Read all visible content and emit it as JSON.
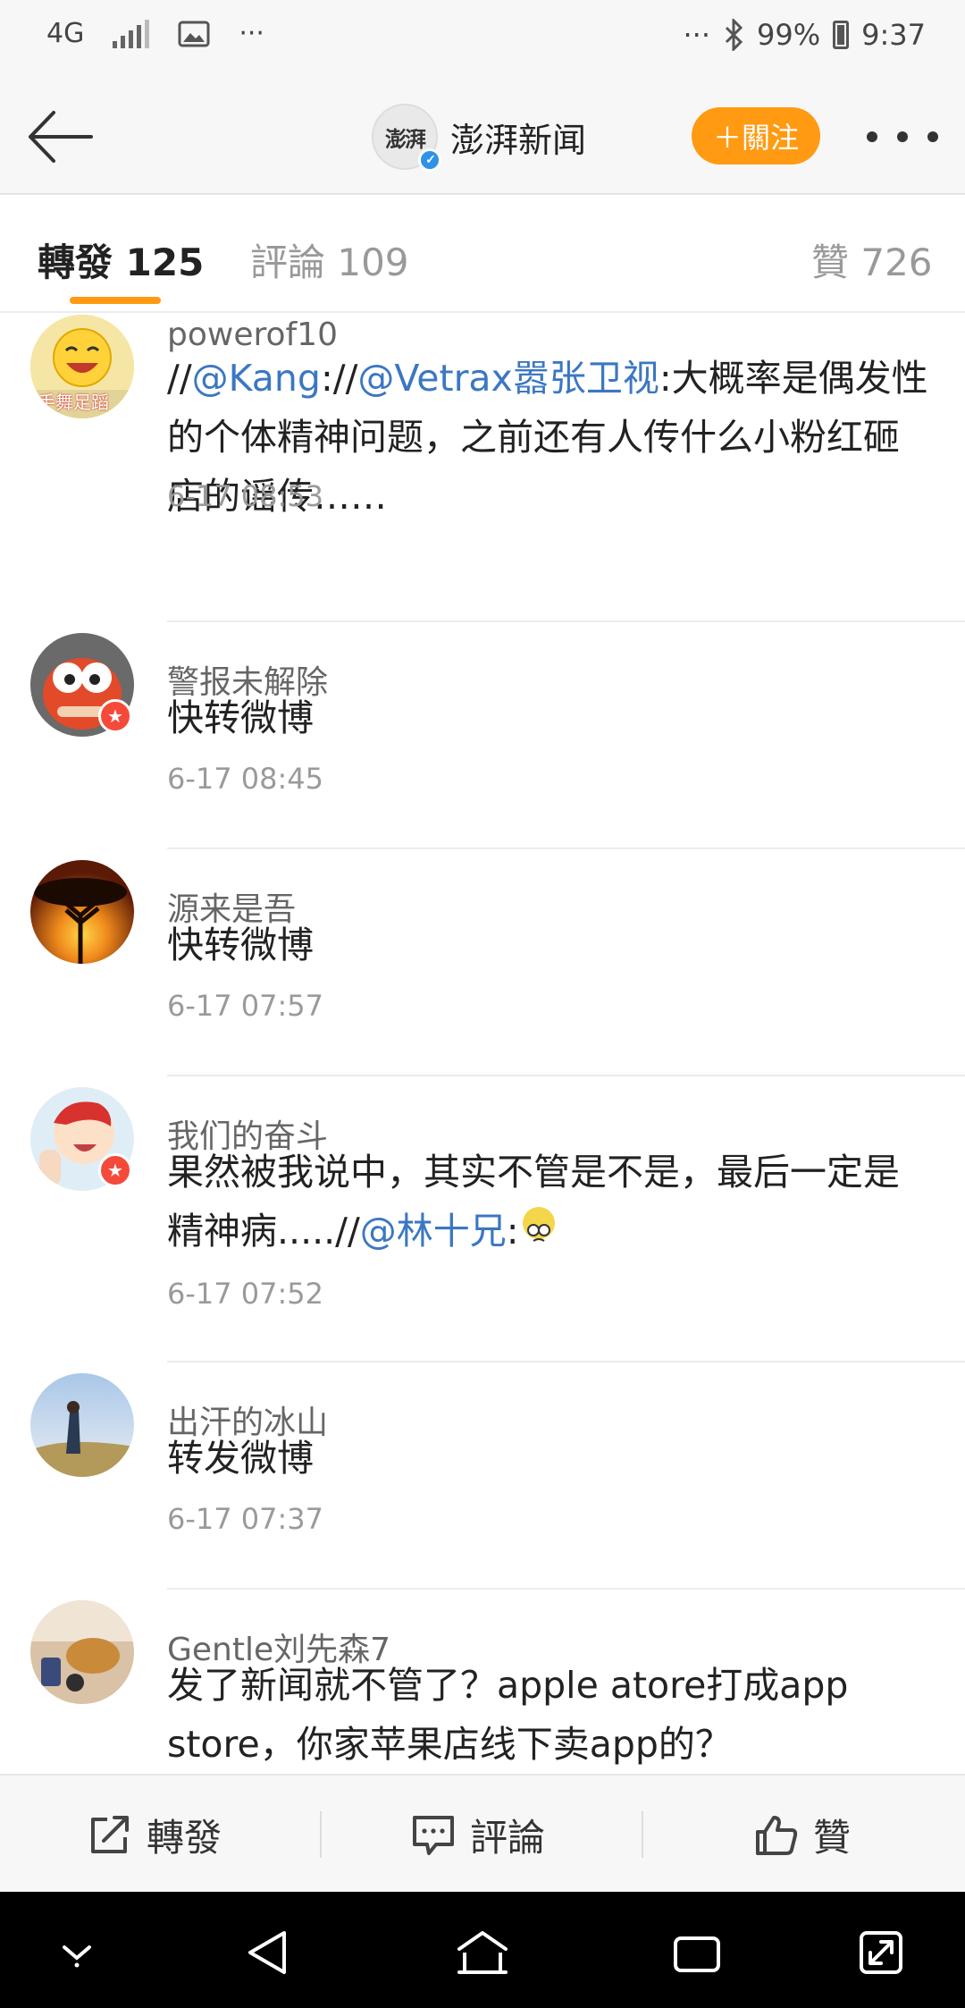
{
  "status_bar": {
    "network": "4G",
    "dots_left": "···",
    "dots_right": "···",
    "battery": "99%",
    "time": "9:37"
  },
  "header": {
    "account_name": "澎湃新闻",
    "logo_text": "澎湃",
    "follow_label": "＋關注"
  },
  "tabs": [
    {
      "label": "轉發 125",
      "active": true
    },
    {
      "label": "評論 109",
      "active": false
    },
    {
      "label": "贊 726",
      "active": false
    }
  ],
  "posts": [
    {
      "user": "powerof10",
      "avatar_text": "手舞足蹈",
      "content": [
        {
          "t": "//"
        },
        {
          "t": "@Kang",
          "at": true
        },
        {
          "t": "://"
        },
        {
          "t": "@Vetrax嚣张卫视",
          "at": true
        },
        {
          "t": ":大概率是偶发性的个体精神问题，之前还有人传什么小粉红砸店的谣传……"
        }
      ],
      "time": "6-17 08:53"
    },
    {
      "user": "警报未解除",
      "content": [
        {
          "t": "快转微博"
        }
      ],
      "time": "6-17 08:45"
    },
    {
      "user": "源来是吾",
      "content": [
        {
          "t": "快转微博"
        }
      ],
      "time": "6-17 07:57"
    },
    {
      "user": "我们的奋斗",
      "content": [
        {
          "t": "果然被我说中，其实不管是不是，最后一定是精神病.....//"
        },
        {
          "t": "@林十兄",
          "at": true
        },
        {
          "t": ":"
        }
      ],
      "time": "6-17 07:52"
    },
    {
      "user": "出汗的冰山",
      "content": [
        {
          "t": "转发微博"
        }
      ],
      "time": "6-17 07:37"
    },
    {
      "user": "Gentle刘先森7",
      "content": [
        {
          "t": "发了新闻就不管了？apple atore打成app store，你家苹果店线下卖app的？"
        }
      ],
      "time": ""
    }
  ],
  "actions": {
    "repost": "轉發",
    "comment": "評論",
    "like": "贊"
  },
  "colors": {
    "accent": "#ff9a12",
    "link": "#3b77c2",
    "verified": "#2f92e8",
    "vip_badge": "#f54a3a"
  }
}
